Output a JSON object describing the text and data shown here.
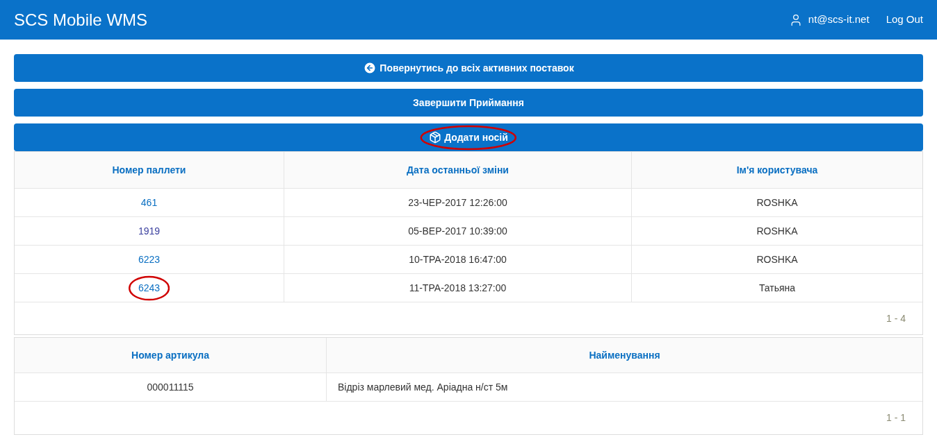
{
  "header": {
    "title": "SCS Mobile WMS",
    "user": "nt@scs-it.net",
    "logout": "Log Out"
  },
  "buttons": [
    {
      "kind": "back",
      "label": "Повернутись до всіх активних поставок",
      "circled": false
    },
    {
      "kind": "plain",
      "label": "Завершити Приймання",
      "circled": false
    },
    {
      "kind": "box",
      "label": "Додати носій",
      "circled": true
    }
  ],
  "pallets": {
    "columns": [
      "Номер паллети",
      "Дата останньої зміни",
      "Ім'я користувача"
    ],
    "rows": [
      {
        "number": "461",
        "date": "23-ЧЕР-2017 12:26:00",
        "user": "ROSHKA",
        "visited": false,
        "circled": false
      },
      {
        "number": "1919",
        "date": "05-ВЕР-2017 10:39:00",
        "user": "ROSHKA",
        "visited": true,
        "circled": false
      },
      {
        "number": "6223",
        "date": "10-ТРА-2018 16:47:00",
        "user": "ROSHKA",
        "visited": false,
        "circled": false
      },
      {
        "number": "6243",
        "date": "11-ТРА-2018 13:27:00",
        "user": "Татьяна",
        "visited": false,
        "circled": true
      }
    ],
    "pager": "1 - 4"
  },
  "articles": {
    "columns": [
      "Номер артикула",
      "Найменування"
    ],
    "rows": [
      {
        "number": "000011115",
        "name": "Відріз марлевий мед. Аріадна н/ст 5м"
      }
    ],
    "pager": "1 - 1"
  }
}
